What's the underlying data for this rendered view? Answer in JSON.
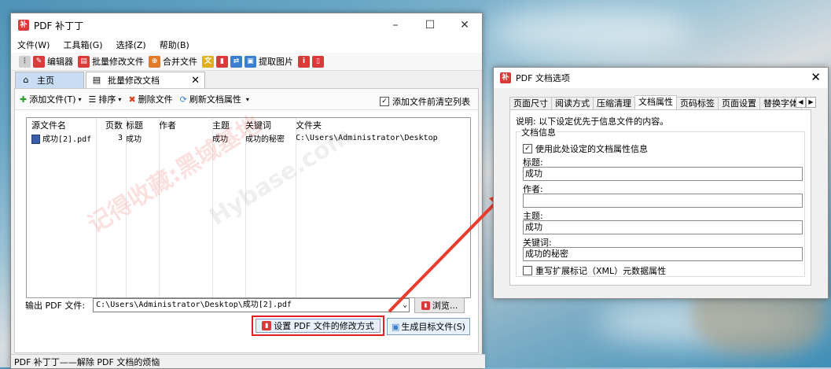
{
  "main": {
    "title": "PDF 补丁丁",
    "menu": [
      "文件(W)",
      "工具箱(G)",
      "选择(Z)",
      "帮助(B)"
    ],
    "toolbar": {
      "editor": "编辑器",
      "batch_modify": "批量修改文件",
      "merge": "合并文件",
      "extract_images": "提取图片"
    },
    "tabs": {
      "home": "主页",
      "batch": "批量修改文档"
    },
    "subbar": {
      "add_file": "添加文件(T)",
      "sort": "排序",
      "delete": "删除文件",
      "refresh": "刷新文档属性",
      "clear_before_add": "添加文件前清空列表"
    },
    "list": {
      "headers": [
        "源文件名",
        "页数",
        "标题",
        "作者",
        "主题",
        "关键词",
        "文件夹"
      ],
      "rows": [
        {
          "file": "成功[2].pdf",
          "pages": "3",
          "title": "成功",
          "author": "",
          "subject": "成功",
          "keywords": "成功的秘密",
          "folder": "C:\\Users\\Administrator\\Desktop"
        }
      ]
    },
    "output": {
      "label": "输出 PDF 文件:",
      "value": "C:\\Users\\Administrator\\Desktop\\成功[2].pdf",
      "browse": "浏览..."
    },
    "set_mode_button": "设置 PDF 文件的修改方式",
    "generate_button": "生成目标文件(S)",
    "status": "PDF 补丁丁——解除 PDF 文档的烦恼",
    "watermark": "记得收藏:黑域基地",
    "watermark_en": "Hybase.com"
  },
  "options": {
    "title": "PDF 文档选项",
    "tabs": [
      "页面尺寸",
      "阅读方式",
      "压缩清理",
      "文档属性",
      "页码标签",
      "页面设置",
      "替换字体"
    ],
    "active_tab": "文档属性",
    "note": "说明: 以下设定优先于信息文件的内容。",
    "group_label": "文档信息",
    "use_settings": "使用此处设定的文档属性信息",
    "fields": {
      "title_label": "标题:",
      "title_value": "成功",
      "author_label": "作者:",
      "author_value": "",
      "subject_label": "主题:",
      "subject_value": "成功",
      "keywords_label": "关键词:",
      "keywords_value": "成功的秘密"
    },
    "rewrite_xmp": "重写扩展标记（XML）元数据属性"
  },
  "colors": {
    "highlight": "#e02020",
    "tab_home": "#c8ddf3",
    "button_bg": "#e8f0fb"
  }
}
